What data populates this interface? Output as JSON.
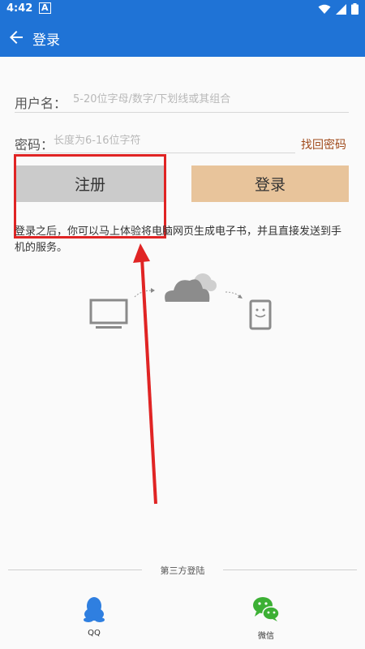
{
  "status": {
    "time": "4:42",
    "notif": "A"
  },
  "appbar": {
    "title": "登录"
  },
  "form": {
    "username_label": "用户名：",
    "username_placeholder": "5-20位字母/数字/下划线或其组合",
    "password_label": "密码：",
    "password_placeholder": "长度为6-16位字符",
    "forgot_label": "找回密码"
  },
  "buttons": {
    "register_label": "注册",
    "login_label": "登录"
  },
  "description": "登录之后，你可以马上体验将电脑网页生成电子书，并且直接发送到手机的服务。",
  "third_party": {
    "title": "第三方登陆",
    "items": [
      {
        "label": "QQ",
        "icon": "qq-penguin-icon"
      },
      {
        "label": "微信",
        "icon": "wechat-icon"
      }
    ]
  },
  "colors": {
    "appbar": "#1f73d6",
    "register_bg": "#cbcbcb",
    "login_bg": "#e8c49b",
    "forgot_text": "#a04a1b",
    "annotation": "#e02424",
    "qq_blue": "#2f7fe0",
    "wechat_green": "#3cb034"
  }
}
